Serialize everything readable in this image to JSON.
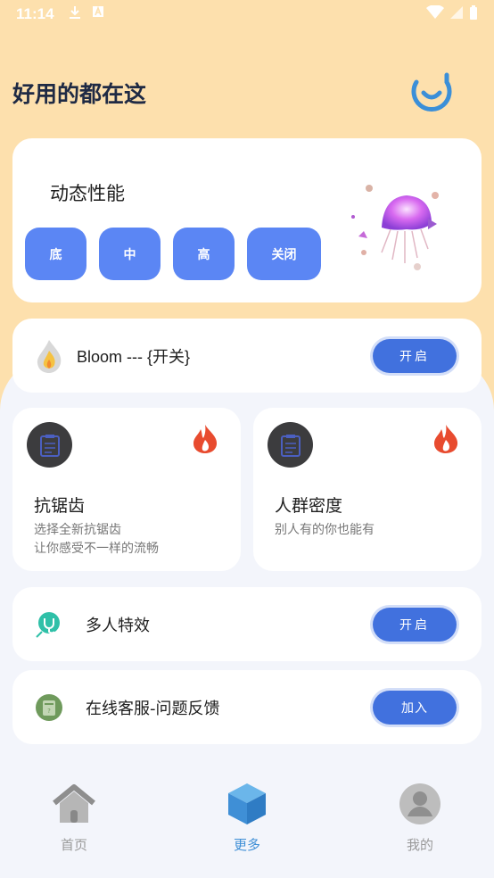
{
  "status_bar": {
    "time": "11:14"
  },
  "header": {
    "title": "好用的都在这"
  },
  "performance": {
    "title": "动态性能",
    "options": [
      "底",
      "中",
      "高",
      "关闭"
    ]
  },
  "bloom": {
    "label": "Bloom --- {开关}",
    "toggle": "开启"
  },
  "features": [
    {
      "title": "抗锯齿",
      "desc_line1": "选择全新抗锯齿",
      "desc_line2": "让你感受不一样的流畅"
    },
    {
      "title": "人群密度",
      "desc_line1": "别人有的你也能有",
      "desc_line2": ""
    }
  ],
  "multi_effect": {
    "label": "多人特效",
    "toggle": "开启"
  },
  "support": {
    "label": "在线客服-问题反馈",
    "button": "加入"
  },
  "nav": [
    {
      "label": "首页",
      "icon": "home-icon"
    },
    {
      "label": "更多",
      "icon": "cube-icon"
    },
    {
      "label": "我的",
      "icon": "user-icon"
    }
  ],
  "colors": {
    "accent": "#5b86f4",
    "toggle": "#4171de",
    "header_bg": "#fde0ad",
    "active_nav": "#3f8fd6"
  }
}
